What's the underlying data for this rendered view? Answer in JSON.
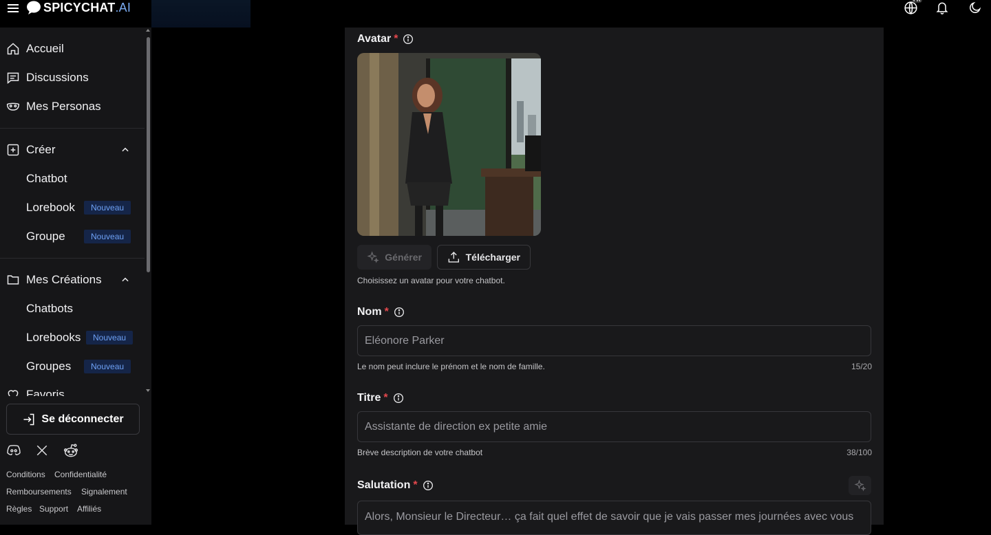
{
  "app": {
    "brand_main": "SPICYCHAT",
    "brand_suffix": ".AI",
    "lang_badge": "FR"
  },
  "sidebar": {
    "items": [
      {
        "label": "Accueil",
        "icon": "home-icon"
      },
      {
        "label": "Discussions",
        "icon": "chat-icon"
      },
      {
        "label": "Mes Personas",
        "icon": "mask-icon"
      }
    ],
    "create": {
      "label": "Créer",
      "icon": "plus-square-icon",
      "children": [
        {
          "label": "Chatbot"
        },
        {
          "label": "Lorebook",
          "badge": "Nouveau"
        },
        {
          "label": "Groupe",
          "badge": "Nouveau"
        }
      ]
    },
    "creations": {
      "label": "Mes Créations",
      "icon": "folder-icon",
      "children": [
        {
          "label": "Chatbots"
        },
        {
          "label": "Lorebooks",
          "badge": "Nouveau"
        },
        {
          "label": "Groupes",
          "badge": "Nouveau"
        }
      ]
    },
    "favorites": {
      "label": "Favoris",
      "icon": "heart-icon"
    },
    "logout_label": "Se déconnecter",
    "social": [
      "discord-icon",
      "x-icon",
      "reddit-icon"
    ],
    "footer_links": [
      [
        "Conditions",
        "Confidentialité"
      ],
      [
        "Remboursements",
        "Signalement"
      ],
      [
        "Règles",
        "Support",
        "Affiliés"
      ]
    ]
  },
  "form": {
    "avatar": {
      "label": "Avatar",
      "required": "*",
      "generate_label": "Générer",
      "upload_label": "Télécharger",
      "helper": "Choisissez un avatar pour votre chatbot."
    },
    "name": {
      "label": "Nom",
      "required": "*",
      "value": "Eléonore Parker",
      "helper": "Le nom peut inclure le prénom et le nom de famille.",
      "counter": "15/20"
    },
    "title": {
      "label": "Titre",
      "required": "*",
      "value": "Assistante de direction ex petite amie",
      "helper": "Brève description de votre chatbot",
      "counter": "38/100"
    },
    "greeting": {
      "label": "Salutation",
      "required": "*",
      "value": "Alors, Monsieur le Directeur… ça fait quel effet de savoir que je vais passer mes journées avec vous"
    }
  },
  "colors": {
    "background": "#000000",
    "sidebar": "#161618",
    "panel": "#19191b",
    "accent_badge_bg": "#152548",
    "accent_badge_text": "#6ea1f5",
    "required": "#e5484d"
  }
}
